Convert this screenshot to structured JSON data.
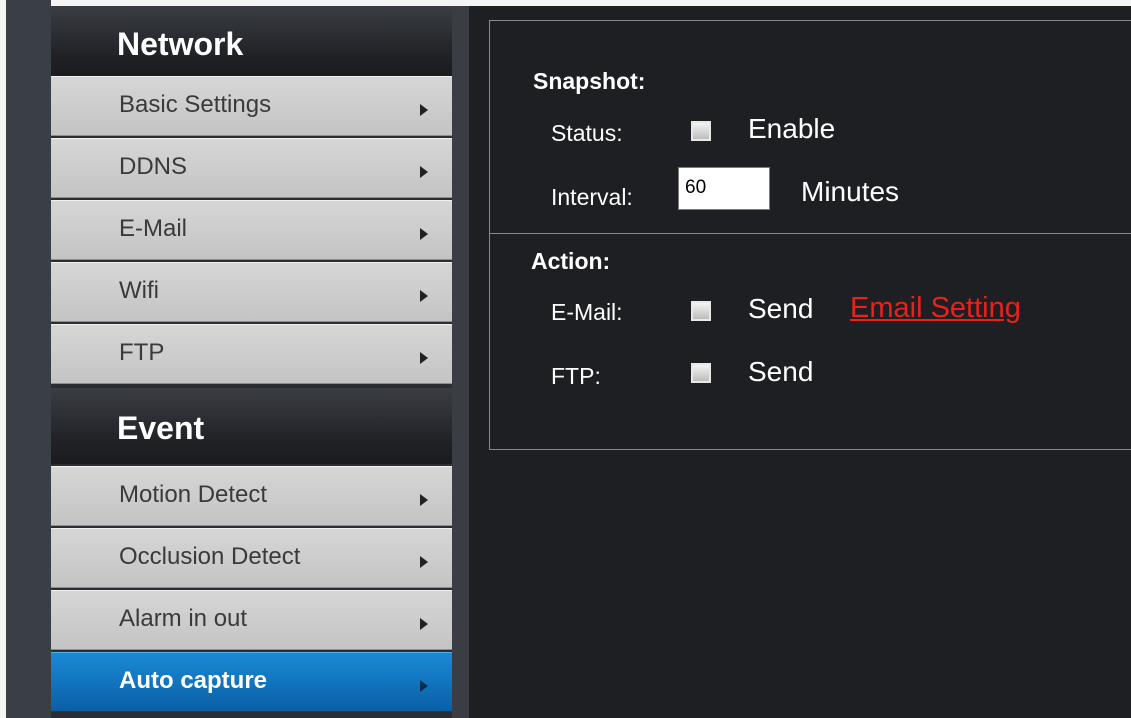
{
  "sidebar": {
    "network_header": "Network",
    "event_header": "Event",
    "network_items": [
      {
        "label": "Basic Settings"
      },
      {
        "label": "DDNS"
      },
      {
        "label": "E-Mail"
      },
      {
        "label": "Wifi"
      },
      {
        "label": "FTP"
      }
    ],
    "event_items": [
      {
        "label": "Motion Detect"
      },
      {
        "label": "Occlusion Detect"
      },
      {
        "label": "Alarm in out"
      },
      {
        "label": "Auto capture",
        "active": true
      }
    ]
  },
  "snapshot": {
    "title": "Snapshot:",
    "status_label": "Status:",
    "status_option": "Enable",
    "status_checked": false,
    "interval_label": "Interval:",
    "interval_value": "60",
    "interval_unit": "Minutes"
  },
  "action": {
    "title": "Action:",
    "email_label": "E-Mail:",
    "email_option": "Send",
    "email_checked": false,
    "email_link": "Email Setting",
    "ftp_label": "FTP:",
    "ftp_option": "Send",
    "ftp_checked": false
  },
  "colors": {
    "active_item": "#0a5fa6",
    "link": "#e8211c"
  }
}
